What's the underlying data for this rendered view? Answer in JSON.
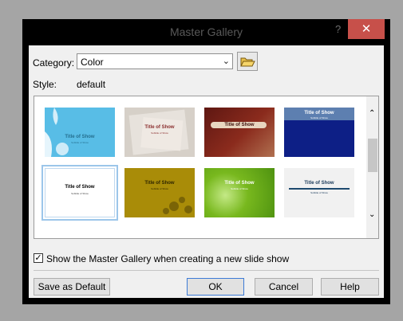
{
  "window": {
    "title": "Master Gallery",
    "help_glyph": "?",
    "close_glyph": "✕"
  },
  "category": {
    "label": "Category:",
    "value": "Color",
    "open_folder_icon": "open-folder-icon"
  },
  "style": {
    "label": "Style:",
    "value": "default"
  },
  "gallery": {
    "thumbnails": [
      {
        "title": "Title of Show",
        "subtitle": "Subtitle of Show",
        "theme": "light-blue-swirl"
      },
      {
        "title": "Title of Show",
        "subtitle": "Subtitle of Show",
        "theme": "gray-paper"
      },
      {
        "title": "Title of Show",
        "subtitle": "",
        "theme": "maroon-gradient"
      },
      {
        "title": "Title of Show",
        "subtitle": "Subtitle of Show",
        "theme": "navy-blue"
      },
      {
        "title": "Title of Show",
        "subtitle": "Subtitle of Show",
        "theme": "white-default",
        "selected": true
      },
      {
        "title": "Title of Show",
        "subtitle": "Subtitle of Show",
        "theme": "olive-floral"
      },
      {
        "title": "Title of Show",
        "subtitle": "Subtitle of Show",
        "theme": "green-abstract"
      },
      {
        "title": "Title of Show",
        "subtitle": "Subtitle of Show",
        "theme": "light-gray-bar"
      }
    ]
  },
  "options": {
    "show_gallery_label": "Show the Master Gallery when creating a new slide show",
    "show_gallery_checked": true
  },
  "buttons": {
    "save_default": "Save as Default",
    "ok": "OK",
    "cancel": "Cancel",
    "help": "Help"
  }
}
